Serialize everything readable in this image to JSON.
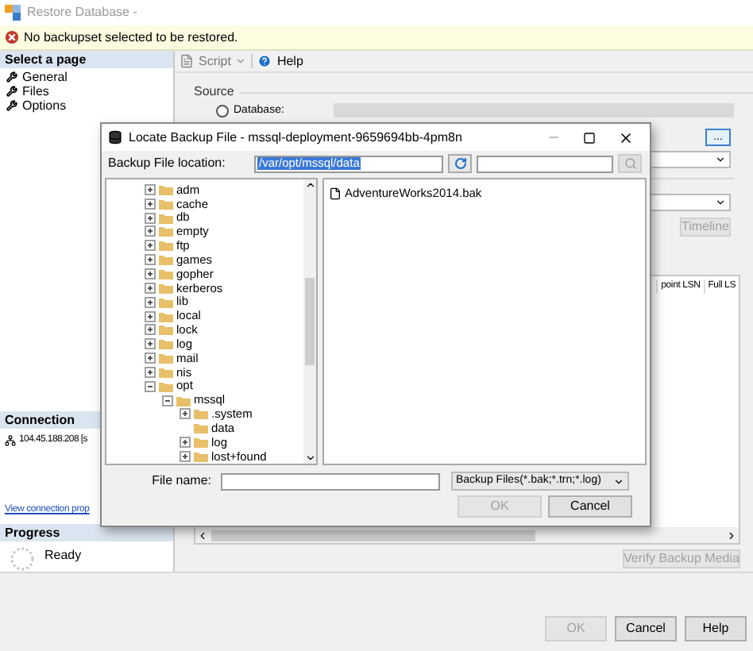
{
  "window": {
    "title": "Restore Database -"
  },
  "message": "No backupset selected to be restored.",
  "sidebar": {
    "header": "Select a page",
    "items": [
      {
        "label": "General"
      },
      {
        "label": "Files"
      },
      {
        "label": "Options"
      }
    ]
  },
  "connection": {
    "header": "Connection",
    "server": "104.45.188.208 [s",
    "link": "View connection prop"
  },
  "progress": {
    "header": "Progress",
    "status": "Ready"
  },
  "toolbar": {
    "script": "Script",
    "help": "Help"
  },
  "source": {
    "label": "Source",
    "database_label": "Database:",
    "database_selected": false
  },
  "browse_button": "...",
  "timeline_button": {
    "label": "Timeline",
    "disabled": true
  },
  "table": {
    "columns": [
      "point LSN",
      "Full LS"
    ]
  },
  "verify_button": {
    "label": "Verify Backup Media",
    "disabled": true
  },
  "buttons": [
    {
      "label": "OK",
      "disabled": true
    },
    {
      "label": "Cancel",
      "disabled": false
    },
    {
      "label": "Help",
      "disabled": false
    }
  ],
  "dialog": {
    "title": "Locate Backup File - mssql-deployment-9659694bb-4pm8n",
    "location_label": "Backup File location:",
    "location_value": "/var/opt/mssql/data",
    "tree": [
      {
        "label": "adm",
        "kind": "branch",
        "expanded": false
      },
      {
        "label": "cache",
        "kind": "branch",
        "expanded": false
      },
      {
        "label": "db",
        "kind": "branch",
        "expanded": false
      },
      {
        "label": "empty",
        "kind": "branch",
        "expanded": false
      },
      {
        "label": "ftp",
        "kind": "branch",
        "expanded": false
      },
      {
        "label": "games",
        "kind": "branch",
        "expanded": false
      },
      {
        "label": "gopher",
        "kind": "branch",
        "expanded": false
      },
      {
        "label": "kerberos",
        "kind": "branch",
        "expanded": false
      },
      {
        "label": "lib",
        "kind": "branch",
        "expanded": false
      },
      {
        "label": "local",
        "kind": "branch",
        "expanded": false
      },
      {
        "label": "lock",
        "kind": "branch",
        "expanded": false
      },
      {
        "label": "log",
        "kind": "branch",
        "expanded": false
      },
      {
        "label": "mail",
        "kind": "branch",
        "expanded": false
      },
      {
        "label": "nis",
        "kind": "branch",
        "expanded": false
      },
      {
        "label": "opt",
        "kind": "branch",
        "expanded": true,
        "children": [
          {
            "label": "mssql",
            "kind": "branch",
            "expanded": true,
            "children": [
              {
                "label": ".system",
                "kind": "branch",
                "expanded": false
              },
              {
                "label": "data",
                "kind": "leaf"
              },
              {
                "label": "log",
                "kind": "branch",
                "expanded": false
              },
              {
                "label": "lost+found",
                "kind": "branch",
                "expanded": false
              }
            ]
          }
        ]
      }
    ],
    "files": [
      {
        "name": "AdventureWorks2014.bak"
      }
    ],
    "file_name_label": "File name:",
    "filter": "Backup Files(*.bak;*.trn;*.log)",
    "buttons": [
      {
        "label": "OK",
        "disabled": true
      },
      {
        "label": "Cancel",
        "disabled": false
      }
    ]
  }
}
